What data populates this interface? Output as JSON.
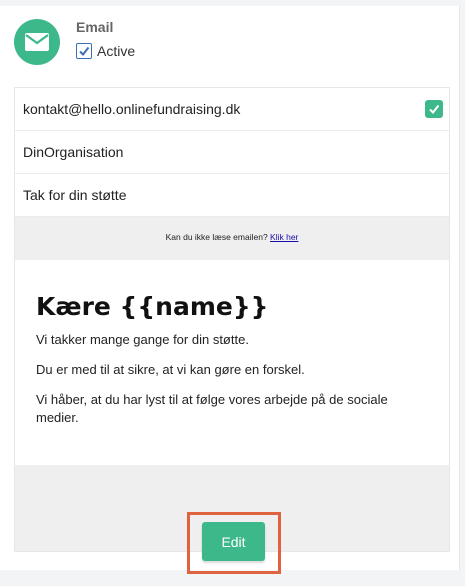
{
  "channel": {
    "title": "Email",
    "active_label": "Active",
    "active_checked": true,
    "icon": "envelope-icon",
    "accent_color": "#3db88a"
  },
  "fields": {
    "sender_email": "kontakt@hello.onlinefundraising.dk",
    "sender_name": "DinOrganisation",
    "subject": "Tak for din støtte"
  },
  "preview": {
    "view_prompt": "Kan du ikke læse emailen?",
    "view_link": "Klik her",
    "greeting": "Kære {{name}}",
    "paragraphs": [
      "Vi takker mange gange for din støtte.",
      "Du er med til at sikre, at vi kan gøre en forskel.",
      "Vi håber, at du har lyst til at følge vores arbejde på de sociale medier."
    ]
  },
  "actions": {
    "edit_label": "Edit",
    "highlight_color": "#e0633f"
  }
}
